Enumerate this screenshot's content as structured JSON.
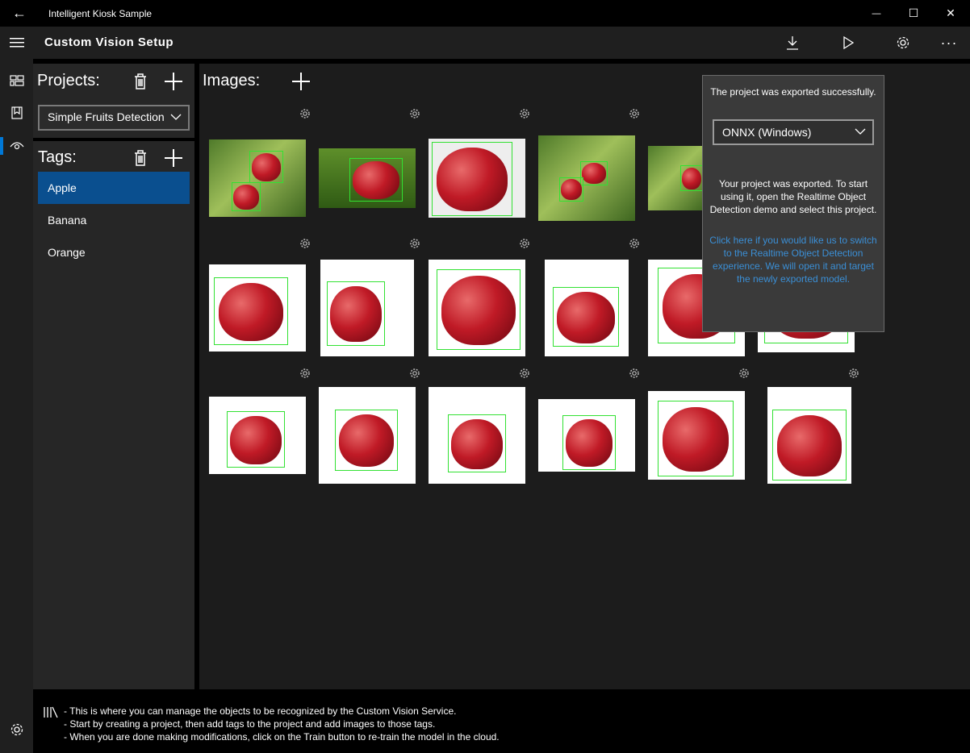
{
  "window": {
    "title": "Intelligent Kiosk Sample",
    "back_glyph": "←",
    "minimize_glyph": "—",
    "maximize_glyph": "☐",
    "close_glyph": "✕"
  },
  "header": {
    "title": "Custom Vision Setup",
    "more_glyph": "···"
  },
  "projects": {
    "title": "Projects:",
    "selected": "Simple Fruits Detection"
  },
  "tags": {
    "title": "Tags:",
    "items": [
      {
        "label": "Apple",
        "selected": true
      },
      {
        "label": "Banana",
        "selected": false
      },
      {
        "label": "Orange",
        "selected": false
      }
    ]
  },
  "images": {
    "title": "Images:"
  },
  "popup": {
    "title": "The project was exported successfully.",
    "format": "ONNX (Windows)",
    "message": "Your project was exported. To start using it, open the Realtime Object Detection demo and select this project.",
    "link": "Click here if you would like us to switch to the Realtime Object Detection experience. We will open it and target the newly exported model."
  },
  "footer": {
    "lines": [
      "- This is where you can manage the objects to be recognized by the Custom Vision Service.",
      "- Start by creating a project, then add tags to the project and add images to those tags.",
      "- When you are done making modifications, click on the Train button to re-train the model in the cloud."
    ]
  },
  "colors": {
    "accent": "#0078d7",
    "selected_tag": "#0a4f8f",
    "bbox": "#32e132",
    "link": "#3a8fd6"
  }
}
